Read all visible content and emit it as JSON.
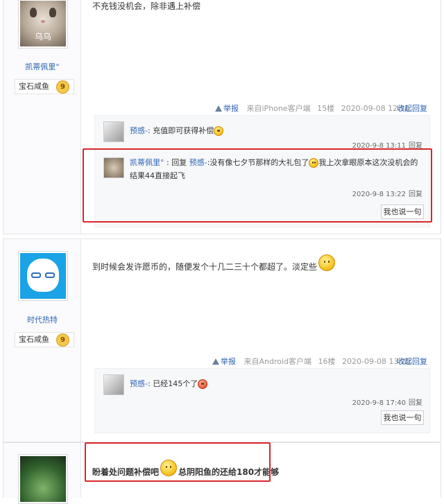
{
  "post1": {
    "avatar_caption": "乌乌",
    "username": "凯蒂佩里°",
    "badge": "宝石咸鱼",
    "level": "9",
    "text": "不充钱没机会，除非遇上补偿",
    "report": "举报",
    "source": "来自iPhone客户端",
    "floor": "15楼",
    "datetime": "2020-09-08 12:50",
    "collapse": "收起回复",
    "replies": [
      {
        "user": "预感-",
        "sep": ":",
        "text": "充值即可获得补偿",
        "time": "2020-9-8 13:11",
        "reply": "回复"
      },
      {
        "user": "凯蒂佩里°",
        "sep": " :",
        "reply_word": "回复",
        "target": "预感-",
        "text1": ":没有像七夕节那样的大礼包了",
        "text2": "我上次拿眼原本这次没机会的结果44直接起飞",
        "time": "2020-9-8 13:22",
        "reply": "回复"
      }
    ],
    "say_button": "我也说一句"
  },
  "post2": {
    "username": "时代热特",
    "badge": "宝石咸鱼",
    "level": "9",
    "text": "到时候会发许愿币的，随便发个十几二三十个都超了。淡定些",
    "report": "举报",
    "source": "来自Android客户端",
    "floor": "16楼",
    "datetime": "2020-09-08 13:20",
    "collapse": "收起回复",
    "replies": [
      {
        "user": "预感-",
        "sep": ":",
        "text": "已经145个了",
        "time": "2020-9-8 17:40",
        "reply": "回复"
      }
    ],
    "say_button": "我也说一句"
  },
  "post3": {
    "text1": "盼着处问题补偿吧",
    "text2": "总阴阳鱼的还给180才能够"
  },
  "colors": {
    "link": "#2d64b3",
    "highlight": "#d8262b"
  }
}
